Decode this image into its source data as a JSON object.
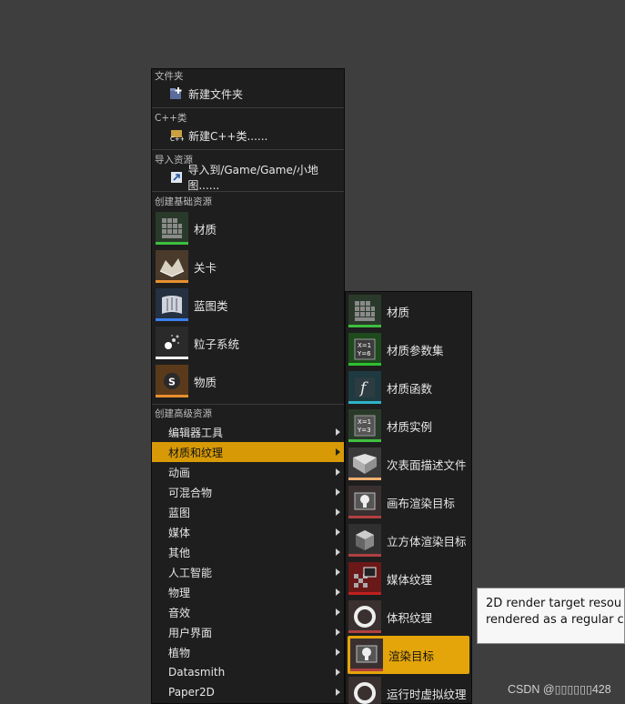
{
  "main_menu": {
    "sections": {
      "folder": {
        "header": "文件夹",
        "item": "新建文件夹"
      },
      "cpp": {
        "header": "C++类",
        "item": "新建C++类......"
      },
      "import": {
        "header": "导入资源",
        "item": "导入到/Game/Game/小地图......"
      },
      "basic": {
        "header": "创建基础资源",
        "items": [
          {
            "label": "材质",
            "icon": "material-icon",
            "bar_color": "#3fbf3f"
          },
          {
            "label": "关卡",
            "icon": "level-icon",
            "bar_color": "#e8902e"
          },
          {
            "label": "蓝图类",
            "icon": "blueprint-icon",
            "bar_color": "#3d7ff0"
          },
          {
            "label": "粒子系统",
            "icon": "particle-system-icon",
            "bar_color": "#f0f0f0"
          },
          {
            "label": "物质",
            "icon": "substance-icon",
            "bar_color": "#e8902e"
          }
        ]
      },
      "advanced": {
        "header": "创建高级资源",
        "items": [
          {
            "label": "编辑器工具"
          },
          {
            "label": "材质和纹理",
            "active": true
          },
          {
            "label": "动画"
          },
          {
            "label": "可混合物"
          },
          {
            "label": "蓝图"
          },
          {
            "label": "媒体"
          },
          {
            "label": "其他"
          },
          {
            "label": "人工智能"
          },
          {
            "label": "物理"
          },
          {
            "label": "音效"
          },
          {
            "label": "用户界面"
          },
          {
            "label": "植物"
          },
          {
            "label": "Datasmith"
          },
          {
            "label": "Paper2D"
          }
        ]
      }
    }
  },
  "sub_menu": {
    "items": [
      {
        "label": "材质",
        "icon": "material-icon",
        "bar_color": "#3fbf3f"
      },
      {
        "label": "材质参数集",
        "icon": "material-parameter-collection-icon",
        "bar_color": "#2fbf2f"
      },
      {
        "label": "材质函数",
        "icon": "material-function-icon",
        "bar_color": "#2fb4c8"
      },
      {
        "label": "材质实例",
        "icon": "material-instance-icon",
        "bar_color": "#3fbf3f"
      },
      {
        "label": "次表面描述文件",
        "icon": "subsurface-profile-icon",
        "bar_color": "#f0b070"
      },
      {
        "label": "画布渲染目标",
        "icon": "canvas-render-target-icon",
        "bar_color": "#b04040"
      },
      {
        "label": "立方体渲染目标",
        "icon": "cube-render-target-icon",
        "bar_color": "#b04040"
      },
      {
        "label": "媒体纹理",
        "icon": "media-texture-icon",
        "bar_color": "#c02020"
      },
      {
        "label": "体积纹理",
        "icon": "volume-texture-icon",
        "bar_color": "#b04040"
      },
      {
        "label": "渲染目标",
        "icon": "render-target-icon",
        "bar_color": "#b04040",
        "active": true
      },
      {
        "label": "运行时虚拟纹理",
        "icon": "runtime-virtual-texture-icon",
        "bar_color": "#b04040"
      }
    ]
  },
  "tooltip": {
    "line1": "2D render target resou",
    "line2": "rendered as a regular c"
  },
  "watermark": "CSDN @▯▯▯▯▯▯428"
}
